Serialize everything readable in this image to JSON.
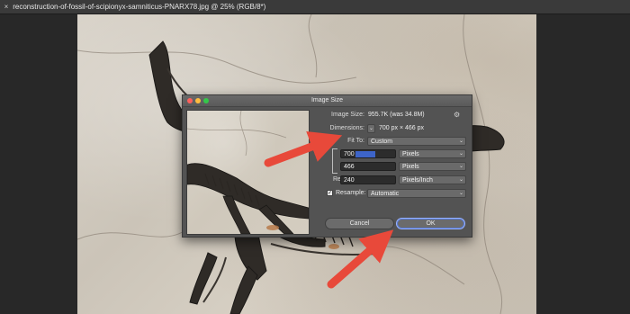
{
  "document": {
    "tab_title": "reconstruction-of-fossil-of-scipionyx-samniticus-PNARX78.jpg @ 25% (RGB/8*)"
  },
  "dialog": {
    "title": "Image Size",
    "image_size_label": "Image Size:",
    "image_size_value": "955.7K (was 34.8M)",
    "dimensions_label": "Dimensions:",
    "dimensions_value": "700 px  ×  466 px",
    "fit_to_label": "Fit To:",
    "fit_to_value": "Custom",
    "width_label": "Width:",
    "width_value": "700",
    "width_unit": "Pixels",
    "height_label": "Height:",
    "height_value": "466",
    "height_unit": "Pixels",
    "resolution_label": "Resolution:",
    "resolution_value": "240",
    "resolution_unit": "Pixels/Inch",
    "resample_label": "Resample:",
    "resample_checked": true,
    "resample_value": "Automatic",
    "cancel_label": "Cancel",
    "ok_label": "OK"
  },
  "colors": {
    "arrow": "#e8493a",
    "dialog_bg": "#535353",
    "accent": "#3d64c8"
  }
}
